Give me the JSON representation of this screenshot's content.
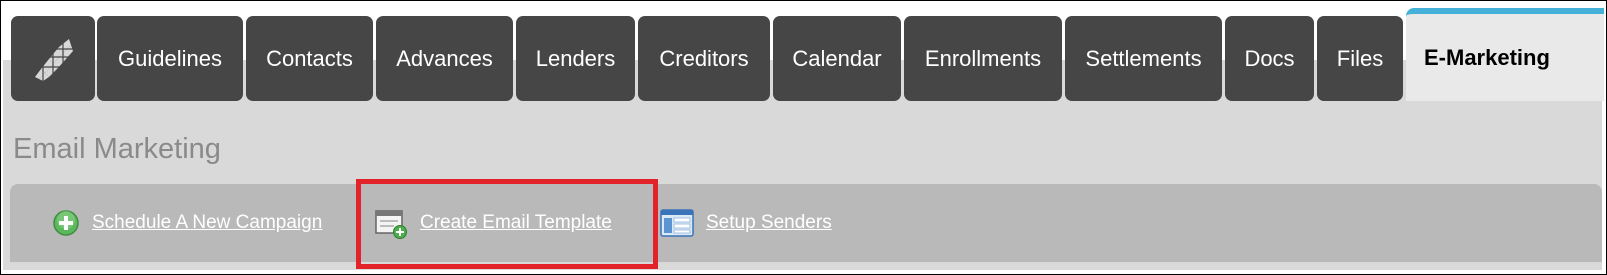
{
  "tabs": [
    {
      "id": "logo",
      "label": "",
      "icon": "app-logo-icon"
    },
    {
      "id": "guidelines",
      "label": "Guidelines"
    },
    {
      "id": "contacts",
      "label": "Contacts"
    },
    {
      "id": "advances",
      "label": "Advances"
    },
    {
      "id": "lenders",
      "label": "Lenders"
    },
    {
      "id": "creditors",
      "label": "Creditors"
    },
    {
      "id": "calendar",
      "label": "Calendar"
    },
    {
      "id": "enrollments",
      "label": "Enrollments"
    },
    {
      "id": "settlements",
      "label": "Settlements"
    },
    {
      "id": "docs",
      "label": "Docs"
    },
    {
      "id": "files",
      "label": "Files"
    },
    {
      "id": "emarketing",
      "label": "E-Marketing",
      "active": true
    }
  ],
  "page": {
    "title": "Email Marketing"
  },
  "toolbar": {
    "schedule_label": "Schedule A New Campaign",
    "create_template_label": "Create Email Template",
    "setup_senders_label": "Setup Senders"
  },
  "colors": {
    "tab_bg": "#464646",
    "active_tab_accent": "#45b0d8",
    "highlight": "#e2232a",
    "add_icon": "#5cb85c"
  }
}
